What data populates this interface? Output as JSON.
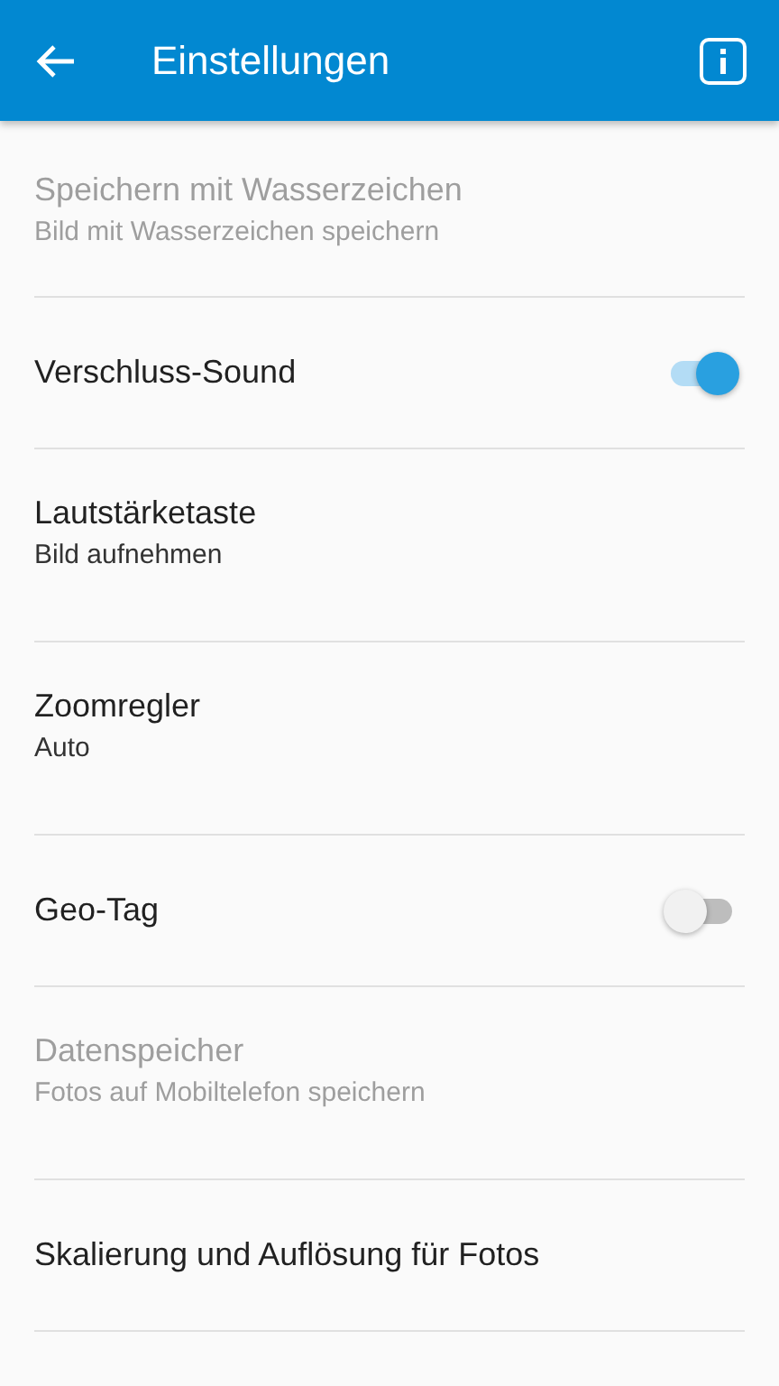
{
  "app_bar": {
    "title": "Einstellungen"
  },
  "settings": [
    {
      "kind": "text",
      "title": "Speichern mit Wasserzeichen",
      "subtitle": "Bild mit Wasserzeichen speichern",
      "disabled": true
    },
    {
      "kind": "toggle",
      "title": "Verschluss-Sound",
      "on": true,
      "disabled": false
    },
    {
      "kind": "text",
      "title": "Lautstärketaste",
      "subtitle": "Bild aufnehmen",
      "disabled": false
    },
    {
      "kind": "text",
      "title": "Zoomregler",
      "subtitle": "Auto",
      "disabled": false
    },
    {
      "kind": "toggle",
      "title": "Geo-Tag",
      "on": false,
      "disabled": false
    },
    {
      "kind": "text",
      "title": "Datenspeicher",
      "subtitle": "Fotos auf Mobiltelefon speichern",
      "disabled": true
    },
    {
      "kind": "text",
      "title": "Skalierung und Auflösung für Fotos",
      "disabled": false
    }
  ]
}
